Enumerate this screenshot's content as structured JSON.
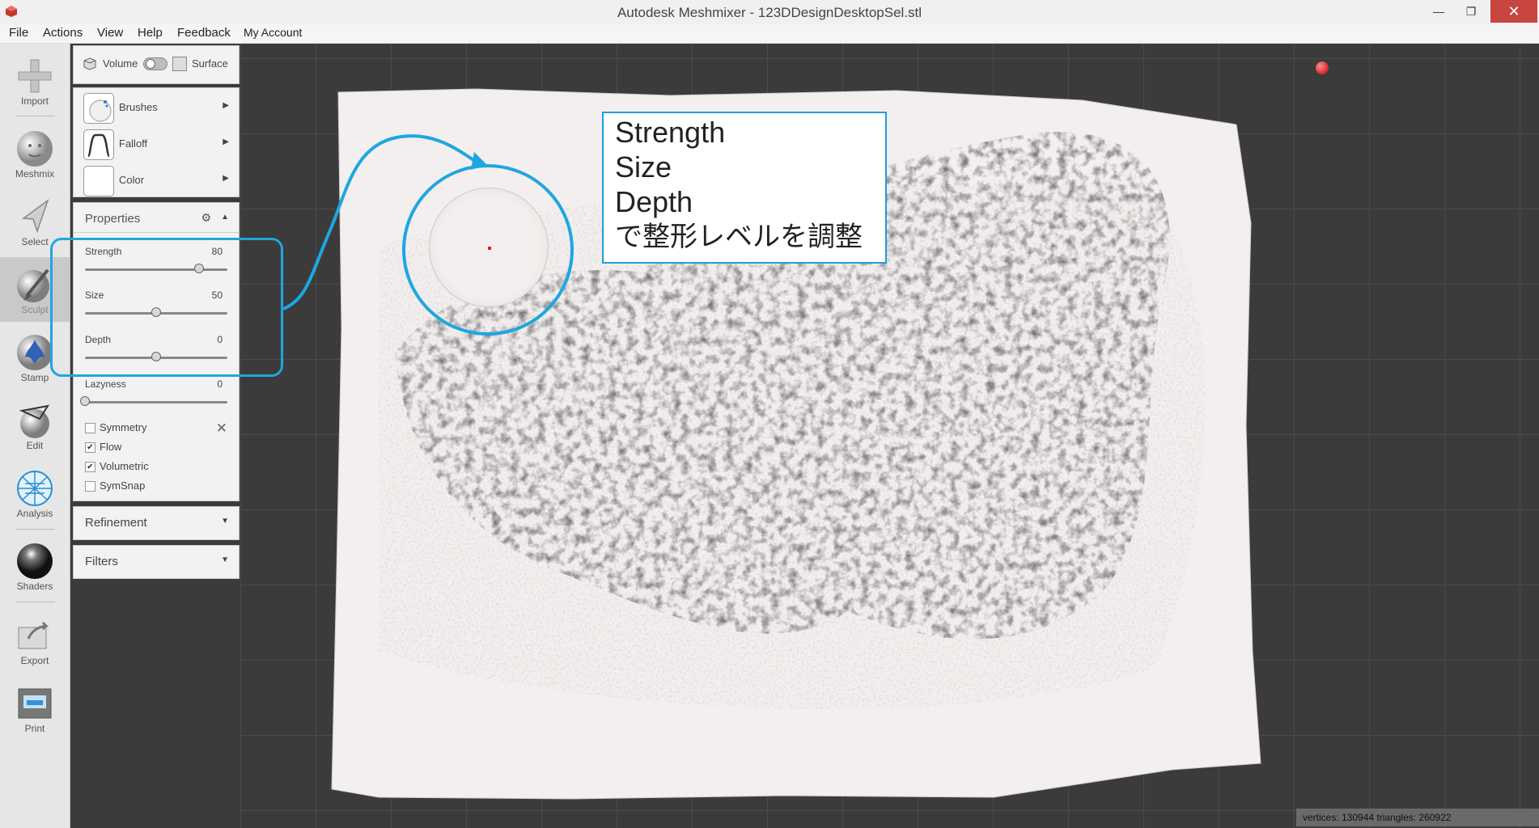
{
  "window": {
    "title": "Autodesk Meshmixer - 123DDesignDesktopSel.stl",
    "min_glyph": "—",
    "max_glyph": "❐",
    "close_glyph": "✕"
  },
  "menu": [
    "File",
    "Actions",
    "View",
    "Help",
    "Feedback",
    "My Account"
  ],
  "toolbar": [
    {
      "label": "Import",
      "icon": "plus-icon"
    },
    {
      "label": "Meshmix",
      "icon": "face-sphere-icon"
    },
    {
      "label": "Select",
      "icon": "cursor-arrow-icon"
    },
    {
      "label": "Sculpt",
      "icon": "brush-icon",
      "active": true
    },
    {
      "label": "Stamp",
      "icon": "stamp-icon"
    },
    {
      "label": "Edit",
      "icon": "edit-sphere-icon"
    },
    {
      "label": "Analysis",
      "icon": "analysis-sphere-icon"
    },
    {
      "label": "Shaders",
      "icon": "shader-ball-icon"
    },
    {
      "label": "Export",
      "icon": "export-icon"
    },
    {
      "label": "Print",
      "icon": "printer-icon"
    }
  ],
  "mode": {
    "volume": "Volume",
    "surface": "Surface"
  },
  "brush_menu": [
    {
      "label": "Brushes"
    },
    {
      "label": "Falloff"
    },
    {
      "label": "Color"
    }
  ],
  "properties": {
    "title": "Properties",
    "sliders": [
      {
        "name": "Strength",
        "value": "80",
        "fraction": 0.8
      },
      {
        "name": "Size",
        "value": "50",
        "fraction": 0.5
      },
      {
        "name": "Depth",
        "value": "0",
        "fraction": 0.5
      },
      {
        "name": "Lazyness",
        "value": "0",
        "fraction": 0.0
      }
    ],
    "checks": [
      {
        "label": "Symmetry",
        "checked": false
      },
      {
        "label": "Flow",
        "checked": true
      },
      {
        "label": "Volumetric",
        "checked": true
      },
      {
        "label": "SymSnap",
        "checked": false
      }
    ]
  },
  "refinement": "Refinement",
  "filters": "Filters",
  "annotation": {
    "lines": [
      "Strength",
      "Size",
      "Depth",
      "で整形レベルを調整"
    ],
    "accent": "#1ea7e0"
  },
  "status": "vertices: 130944 triangles: 260922"
}
